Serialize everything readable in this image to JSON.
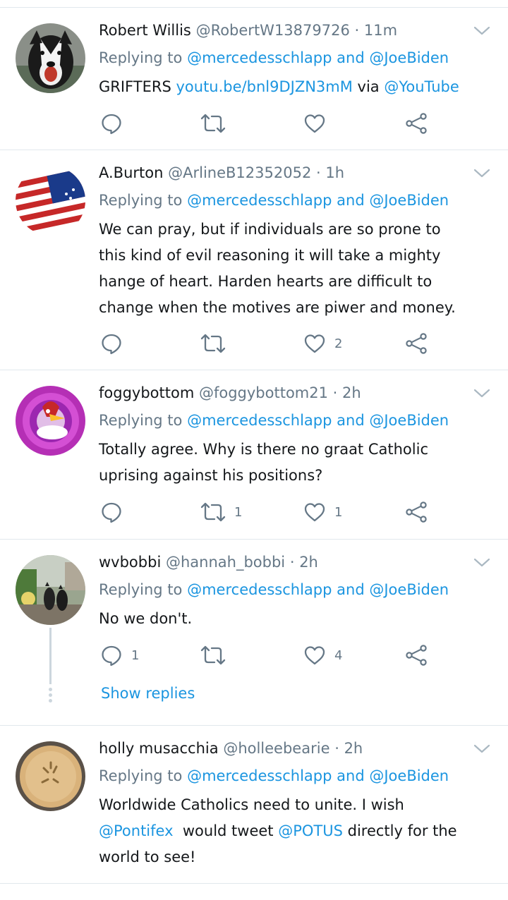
{
  "tweets": [
    {
      "name": "Robert Willis",
      "handle": "@RobertW13879726",
      "sep": "·",
      "time": "11m",
      "replying_prefix": "Replying to",
      "replying_to_1": "@mercedesschlapp",
      "replying_and": "and",
      "replying_to_2": "@JoeBiden",
      "text_plain_1": "GRIFTERS",
      "link": "youtu.be/bnl9DJZN3mM",
      "text_plain_2": "via",
      "link_mention": "@YouTube",
      "reply_count": "",
      "retweet_count": "",
      "like_count": ""
    },
    {
      "name": "A.Burton",
      "handle": "@ArlineB12352052",
      "sep": "·",
      "time": "1h",
      "replying_prefix": "Replying to",
      "replying_to_1": "@mercedesschlapp",
      "replying_and": "and",
      "replying_to_2": "@JoeBiden",
      "lines": [
        "We can pray, but if individuals are so prone to",
        "this kind of evil reasoning it will take a mighty",
        "hange of heart. Harden hearts are difficult to",
        "change when the motives are piwer and money."
      ],
      "reply_count": "",
      "retweet_count": "",
      "like_count": "2"
    },
    {
      "name": "foggybottom",
      "handle": "@foggybottom21",
      "sep": "·",
      "time": "2h",
      "replying_prefix": "Replying to",
      "replying_to_1": "@mercedesschlapp",
      "replying_and": "and",
      "replying_to_2": "@JoeBiden",
      "lines": [
        "Totally agree. Why is there no graat Catholic",
        "uprising against his positions?"
      ],
      "reply_count": "",
      "retweet_count": "1",
      "like_count": "1"
    },
    {
      "name": "wvbobbi",
      "handle": "@hannah_bobbi",
      "sep": "·",
      "time": "2h",
      "replying_prefix": "Replying to",
      "replying_to_1": "@mercedesschlapp",
      "replying_and": "and",
      "replying_to_2": "@JoeBiden",
      "lines": [
        "No we don't."
      ],
      "reply_count": "1",
      "retweet_count": "",
      "like_count": "4",
      "show_replies": "Show replies"
    },
    {
      "name": "holly musacchia",
      "handle": "@holleebearie",
      "sep": "·",
      "time": "2h",
      "replying_prefix": "Replying to",
      "replying_to_1": "@mercedesschlapp",
      "replying_and": "and",
      "replying_to_2": "@JoeBiden",
      "line1": "Worldwide Catholics need to unite.  I wish",
      "line2_mention_1": "@Pontifex",
      "line2_text": "  would tweet ",
      "line2_mention_2": "@POTUS",
      "line2_text_2": " directly for the",
      "line3": "world to see!"
    }
  ],
  "colors": {
    "link": "#1b95e0",
    "secondary_text": "#657786",
    "divider": "#e1e8ed"
  },
  "icons": [
    "reply-icon",
    "retweet-icon",
    "like-icon",
    "share-icon",
    "chevron-down-icon"
  ]
}
